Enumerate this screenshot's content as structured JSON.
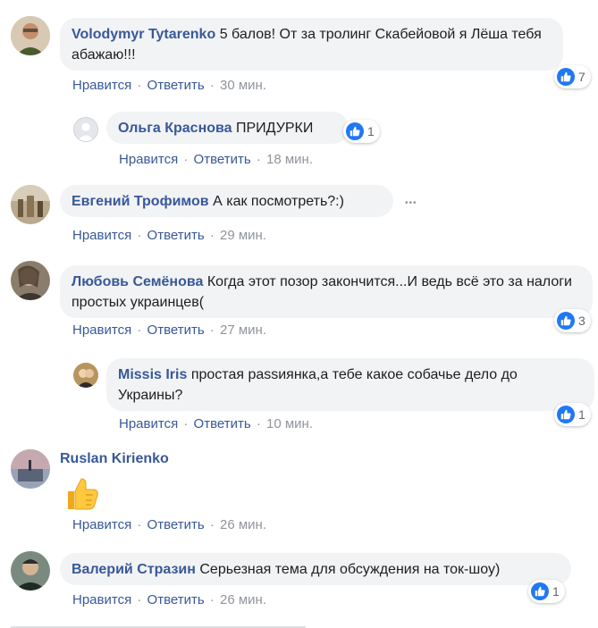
{
  "actions": {
    "like": "Нравится",
    "reply": "Ответить",
    "separator": "·"
  },
  "comments": [
    {
      "author": "Volodymyr Tytarenko",
      "text": "5 балов! От за тролинг Скабейовой я Лёша тебя абажаю!!!",
      "time": "30 мин.",
      "likes": "7"
    },
    {
      "author": "Ольга Краснова",
      "text": "ПРИДУРКИ",
      "time": "18 мин.",
      "likes": "1"
    },
    {
      "author": "Евгений Трофимов",
      "text": "А как посмотреть?:)",
      "time": "29 мин.",
      "more": "•••"
    },
    {
      "author": "Любовь Семёнова",
      "text": "Когда этот позор закончится...И ведь всё это за налоги простых украинцев(",
      "time": "27 мин.",
      "likes": "3"
    },
    {
      "author": "Missis Iris",
      "text": "простая раssиянка,а тебе какое собачье дело до Украины?",
      "time": "10 мин.",
      "likes": "1"
    },
    {
      "author": "Ruslan Kirienko",
      "sticker": "thumbs-up",
      "time": "26 мин."
    },
    {
      "author": "Валерий Стразин",
      "text": "Серьезная тема для обсуждения на ток-шоу)",
      "time": "26 мин.",
      "likes": "1"
    }
  ],
  "colors": {
    "link": "#385898",
    "bubble": "#f2f3f5",
    "like": "#2078f4",
    "meta": "#90949c"
  }
}
